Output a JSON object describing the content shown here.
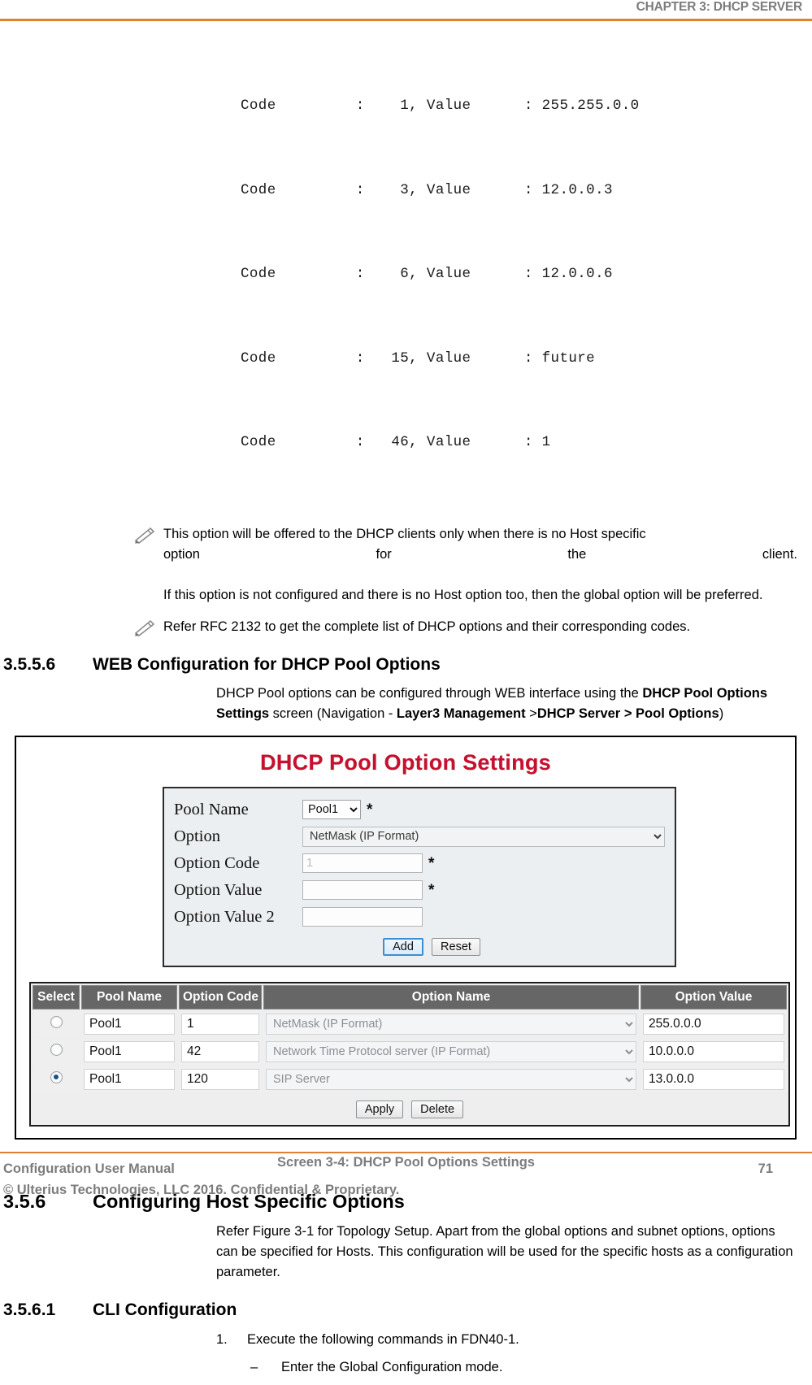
{
  "header": {
    "chapter_title": "CHAPTER 3: DHCP SERVER",
    "rule_color": "#e2802f"
  },
  "cli_output": {
    "lines": [
      "Code         :    1, Value      : 255.255.0.0",
      "Code         :    3, Value      : 12.0.0.3",
      "Code         :    6, Value      : 12.0.0.6",
      "Code         :   15, Value      : future",
      "Code         :   46, Value      : 1"
    ]
  },
  "notes": [
    {
      "icon": "pencil-icon",
      "line1": "This option will be offered to the DHCP clients only when there is no Host specific",
      "line2_a": "option",
      "line2_b": "for",
      "line2_c": "the",
      "line2_d": "client.",
      "line3": "If this option is not configured and there is no Host option too, then the global option will be preferred."
    },
    {
      "icon": "pencil-icon",
      "text": "Refer RFC 2132 to get the complete list of DHCP options and their corresponding codes."
    }
  ],
  "section_3556": {
    "number": "3.5.5.6",
    "title": "WEB Configuration for DHCP Pool Options",
    "para_1": "DHCP Pool options can be configured through WEB interface using the ",
    "para_2_bold": "DHCP Pool Options Settings",
    "para_3": " screen (Navigation - ",
    "para_4_bold": "Layer3 Management",
    "para_5": " >",
    "para_6_bold": "DHCP Server > Pool Options",
    "para_7": ")"
  },
  "screenshot": {
    "title": "DHCP Pool Option Settings",
    "title_color": "#c8102e",
    "form": {
      "pool_name_label": "Pool Name",
      "pool_name_value": "Pool1",
      "pool_name_required": "*",
      "option_label": "Option",
      "option_value": "NetMask (IP Format)",
      "option_code_label": "Option Code",
      "option_code_value": "1",
      "option_code_required": "*",
      "option_value_label": "Option Value",
      "option_value_value": "",
      "option_value_required": "*",
      "option_value2_label": "Option Value 2",
      "option_value2_value": "",
      "add_label": "Add",
      "reset_label": "Reset"
    },
    "table": {
      "columns": [
        "Select",
        "Pool Name",
        "Option Code",
        "Option Name",
        "Option Value"
      ],
      "rows": [
        {
          "selected": false,
          "pool_name": "Pool1",
          "option_code": "1",
          "option_name": "NetMask (IP Format)",
          "option_value": "255.0.0.0"
        },
        {
          "selected": false,
          "pool_name": "Pool1",
          "option_code": "42",
          "option_name": "Network Time Protocol server (IP Format)",
          "option_value": "10.0.0.0"
        },
        {
          "selected": true,
          "pool_name": "Pool1",
          "option_code": "120",
          "option_name": "SIP Server",
          "option_value": "13.0.0.0"
        }
      ],
      "apply_label": "Apply",
      "delete_label": "Delete"
    }
  },
  "figure_caption": "Screen 3-4: DHCP Pool Options Settings",
  "section_356": {
    "number": "3.5.6",
    "title": "Configuring Host Specific Options",
    "paragraph": "Refer Figure 3-1 for Topology Setup. Apart from the global options and subnet options, options can be specified for Hosts. This configuration will be used for the specific hosts as a configuration parameter."
  },
  "section_3561": {
    "number": "3.5.6.1",
    "title": "CLI Configuration",
    "item1_marker": "1.",
    "item1_text": "Execute the following commands in FDN40-1.",
    "sub1_marker": "–",
    "sub1_text": "Enter the Global Configuration mode."
  },
  "footer": {
    "manual_name": "Configuration User Manual",
    "page_number": "71",
    "copyright": "© Ulterius Technologies, LLC 2016. Confidential & Proprietary."
  }
}
